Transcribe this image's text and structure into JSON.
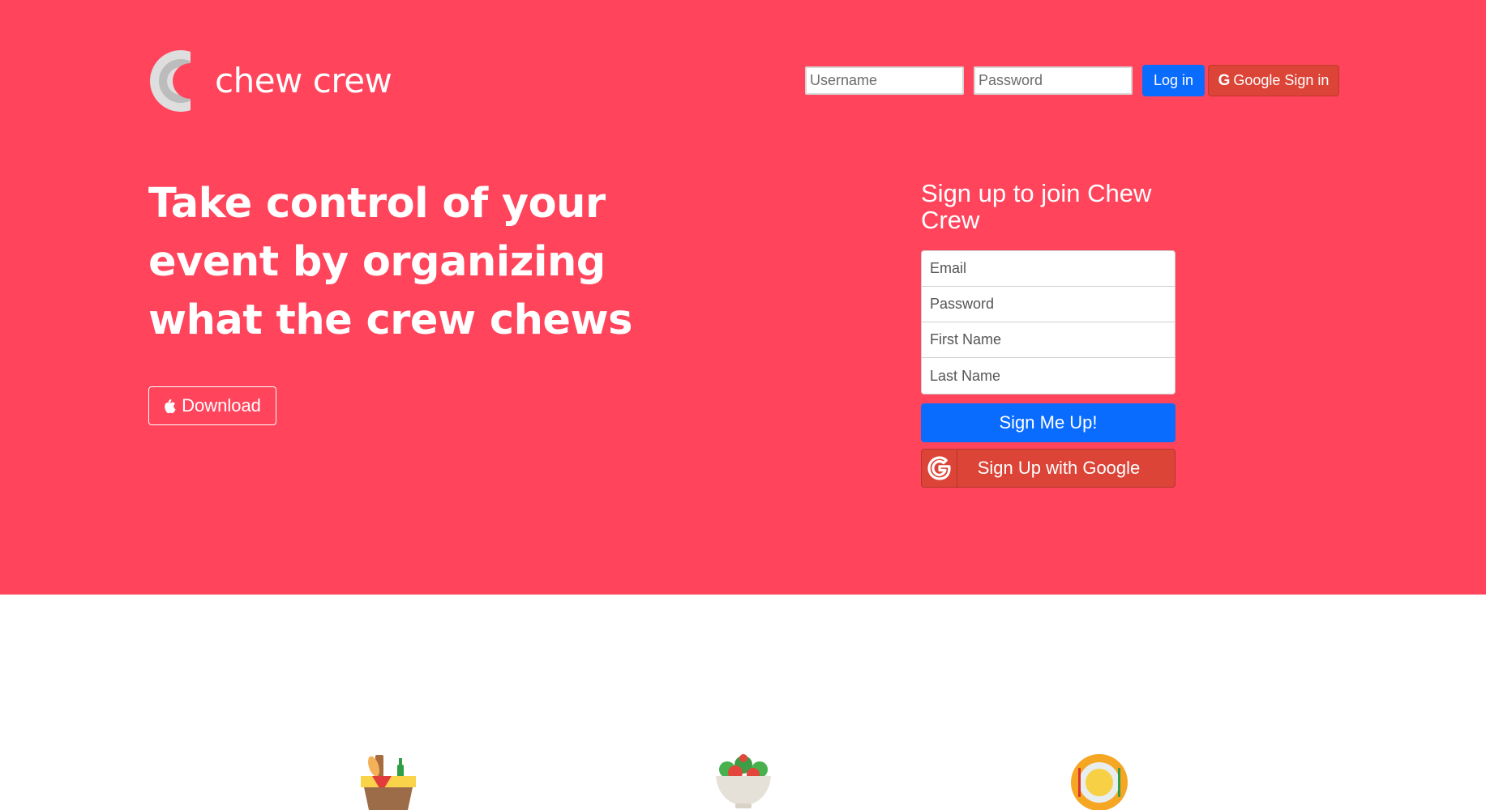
{
  "brand": {
    "name": "chew crew",
    "logo_icon": "chew-crew-logo"
  },
  "login": {
    "username_placeholder": "Username",
    "password_placeholder": "Password",
    "login_label": "Log in",
    "google_label": "Google Sign in",
    "google_icon": "google-g-icon"
  },
  "hero": {
    "headline": "Take control of your event by organizing what the crew chews",
    "download_label": "Download",
    "download_icon": "apple-icon"
  },
  "signup": {
    "title": "Sign up to join Chew Crew",
    "email_placeholder": "Email",
    "password_placeholder": "Password",
    "first_name_placeholder": "First Name",
    "last_name_placeholder": "Last Name",
    "submit_label": "Sign Me Up!",
    "google_label": "Sign Up with Google"
  },
  "features": {
    "icons": [
      "picnic-basket-icon",
      "salad-bowl-icon",
      "plate-cutlery-icon"
    ]
  },
  "colors": {
    "hero_bg": "#ff445c",
    "primary": "#0a6cff",
    "google": "#db4437"
  }
}
